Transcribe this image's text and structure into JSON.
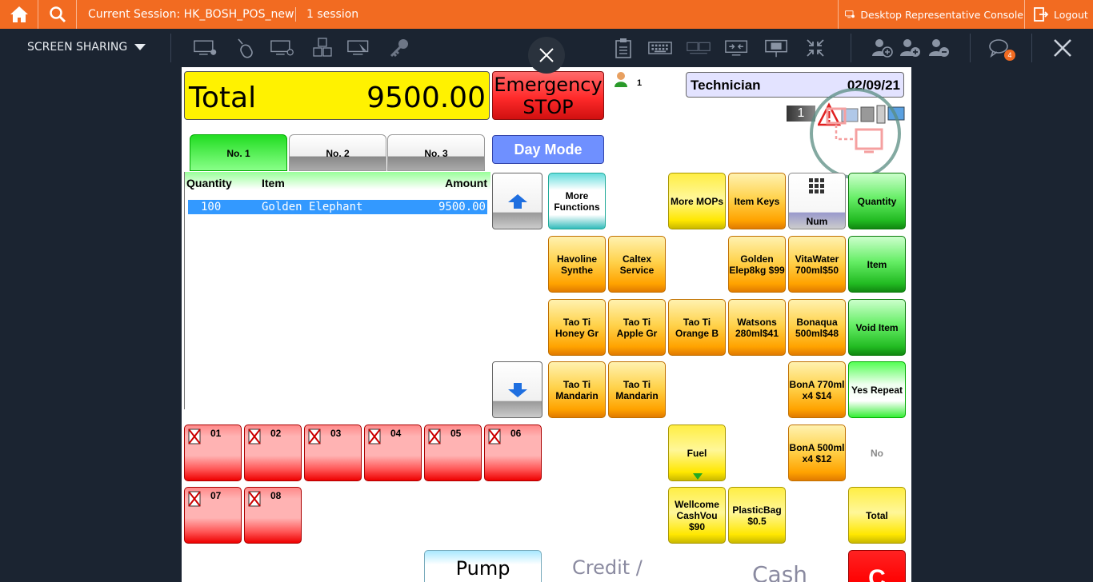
{
  "topbar": {
    "session_label": "Current Session: HK_BOSH_POS_new",
    "session_count": "1 session",
    "console_label": "Desktop Representative Console",
    "logout_label": "Logout"
  },
  "toolbar": {
    "screen_sharing_label": "SCREEN SHARING",
    "chat_badge": "4"
  },
  "pos": {
    "total_label": "Total",
    "total_value": "9500.00",
    "emergency_line1": "Emergency",
    "emergency_line2": "STOP",
    "user_count": "1",
    "operator": "Technician",
    "date": "02/09/21",
    "terminal_badge": "1",
    "tabs": [
      "No. 1",
      "No. 2",
      "No. 3"
    ],
    "day_mode": "Day Mode",
    "list_headers": {
      "quantity": "Quantity",
      "item": "Item",
      "amount": "Amount"
    },
    "list_rows": [
      {
        "quantity": "100",
        "item": "Golden Elephant",
        "amount": "9500.00"
      }
    ],
    "buttons": {
      "more_functions": "More Functions",
      "more_mops": "More MOPs",
      "item_keys": "Item Keys",
      "num": "Num",
      "quantity": "Quantity",
      "havoline": "Havoline Synthe",
      "caltex": "Caltex Service",
      "golden_elep": "Golden Elep8kg $99",
      "vitawater": "VitaWater 700ml$50",
      "item": "Item",
      "taoti_honey": "Tao Ti Honey Gr",
      "taoti_apple": "Tao Ti Apple Gr",
      "taoti_orange": "Tao Ti Orange B",
      "watsons": "Watsons 280ml$41",
      "bonaqua": "Bonaqua 500ml$48",
      "void_item": "Void Item",
      "taoti_mandarin1": "Tao Ti Mandarin",
      "taoti_mandarin2": "Tao Ti Mandarin",
      "bona_770": "BonA 770ml x4 $14",
      "yes_repeat": "Yes Repeat",
      "fuel": "Fuel",
      "bona_500": "BonA 500ml x4 $12",
      "no": "No",
      "wellcome": "Wellcome CashVou $90",
      "plastic_bag": "PlasticBag $0.5",
      "total": "Total",
      "c": "C"
    },
    "pumps": [
      "01",
      "02",
      "03",
      "04",
      "05",
      "06",
      "07",
      "08"
    ],
    "pump_label": "Pump",
    "credit_label": "Credit /",
    "cash_label": "Cash"
  }
}
